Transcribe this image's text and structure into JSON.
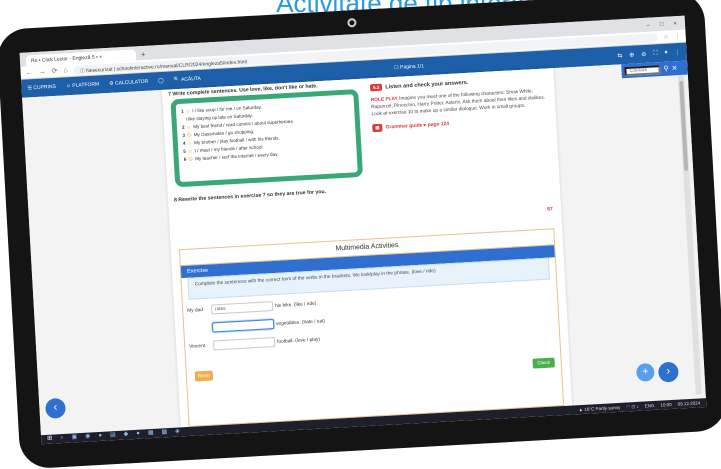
{
  "caption": "Activitate de tip interactiv",
  "browser": {
    "tab_title": "Ro • Click Lector - Engleză 5 • ×",
    "new_tab": "+",
    "window_controls": [
      "–",
      "□",
      "×"
    ],
    "nav": [
      "←",
      "→",
      "⟳",
      "⌂"
    ],
    "url": "ⓘ Nesecurizat | schoolinteractive.ro/manual/CLR/2024/engleza5/index.html",
    "extensions": [
      "☆",
      "⋮"
    ]
  },
  "app_toolbar": {
    "items": [
      "☰ CUPRINS",
      "☺ PLATFORM",
      "⚙ CALCULATOR",
      "◯",
      "🔍 ACĂUTA"
    ],
    "center": "☐ Pagina 1/1",
    "right": [
      "⇆",
      "⊕",
      "⊖",
      "⛶",
      "♦",
      "⋮"
    ]
  },
  "side_panel": {
    "search_placeholder": "Căutare",
    "search_icon": "search-icon",
    "close_icon": "close-icon"
  },
  "exercise7": {
    "header": "7  Write complete sentences. Use love, like, don't like or hate.",
    "sentences": [
      {
        "n": "1",
        "face": "☺",
        "text": "I / like soup / for me / on Saturday."
      },
      {
        "n": "",
        "face": "",
        "text": "I like staying up late on Saturday."
      },
      {
        "n": "2",
        "face": "☺",
        "text": "My best friend / read comics / about superheroes."
      },
      {
        "n": "3",
        "face": "☹",
        "text": "My classmates / go shopping."
      },
      {
        "n": "4",
        "face": "☺",
        "text": "My brother / play football / with his friends."
      },
      {
        "n": "5",
        "face": "☺",
        "text": "I / meet / my friends / after school."
      },
      {
        "n": "6",
        "face": "☹",
        "text": "My teacher / surf the Internet / every day."
      }
    ]
  },
  "right_col": {
    "badge": "5.3",
    "title": "Listen and check your answers.",
    "role_label": "ROLE PLAY",
    "role_text": "Imagine you meet one of the following characters: Snow White, Rapunzel, Pinocchio, Harry Potter, Asterix. Ask them about their likes and dislikes. Look at exercise 10 to make up a similar dialogue. Work in small groups.",
    "grammar": "Grammar guide ▸ page 124"
  },
  "exercise8": "8  Rewrite the sentences in exercise 7 so they are true for you.",
  "page_number": "57",
  "multimedia": {
    "title": "Multimedia Activities",
    "exercise_label": "Exercise",
    "instructions": "Complete the sentences with the correct form of the verbs in the brackets. We look/play in the phrase. (love / ride)",
    "rows": [
      {
        "label": "My dad",
        "value": "rides",
        "suffix": "his bike. (like / ride)"
      },
      {
        "label": "",
        "value": "",
        "suffix": "vegetables. (hate / eat)"
      },
      {
        "label": "Vincent",
        "value": "",
        "suffix": "football. (love / play)"
      }
    ],
    "reset_label": "Reset",
    "check_label": "Check"
  },
  "fabs": {
    "left": "‹",
    "plus": "+",
    "right": "›"
  },
  "taskbar": {
    "icons": [
      "⊞",
      "⌕",
      "▣",
      "◉",
      "●",
      "▤",
      "◆",
      "●",
      "▦",
      "▩",
      "◈"
    ],
    "tray": [
      "▲ 16°C Partly sunny",
      "◠ ⊡ ♪",
      "ENG",
      "10:00",
      "09.12.2024"
    ]
  }
}
